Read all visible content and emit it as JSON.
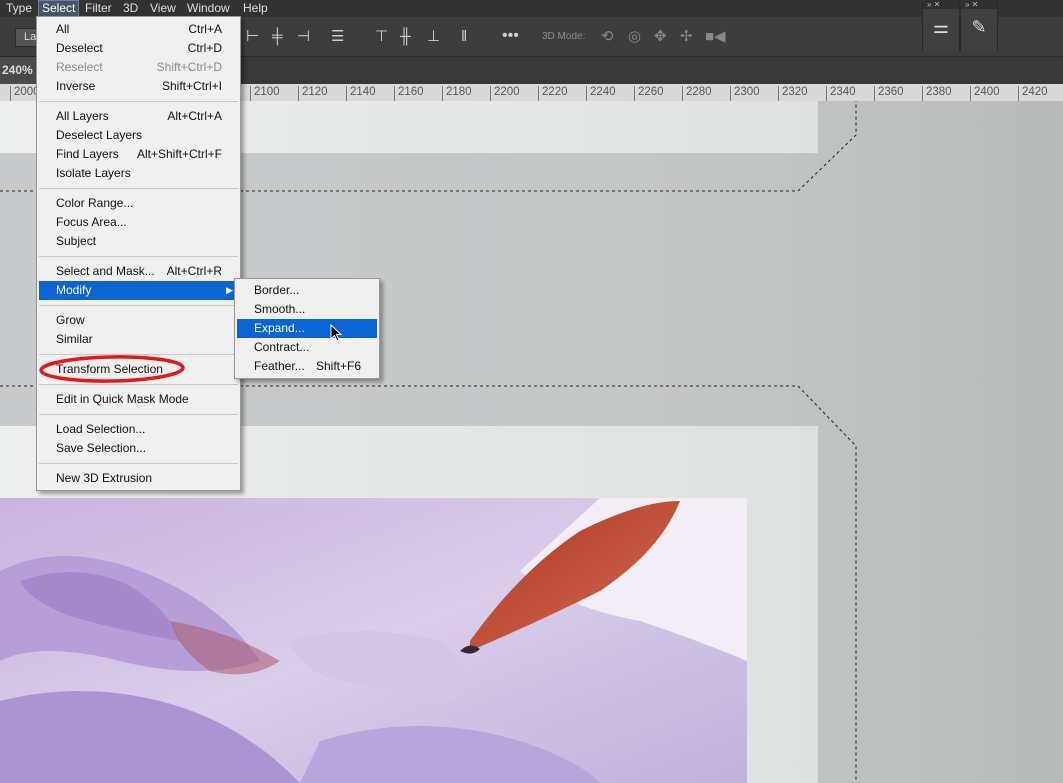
{
  "menubar": [
    "Type",
    "Select",
    "Filter",
    "3D",
    "View",
    "Window",
    "Help"
  ],
  "options": {
    "layer_dropdown": "La",
    "mode3d_label": "3D Mode:"
  },
  "zoom": "240% (",
  "ruler_ticks": [
    "2000",
    "2100",
    "2120",
    "2140",
    "2160",
    "2180",
    "2200",
    "2220",
    "2240",
    "2260",
    "2280",
    "2300",
    "2320",
    "2340",
    "2360",
    "2380",
    "2400",
    "2420"
  ],
  "select_menu": {
    "all": {
      "label": "All",
      "shortcut": "Ctrl+A"
    },
    "deselect": {
      "label": "Deselect",
      "shortcut": "Ctrl+D"
    },
    "reselect": {
      "label": "Reselect",
      "shortcut": "Shift+Ctrl+D"
    },
    "inverse": {
      "label": "Inverse",
      "shortcut": "Shift+Ctrl+I"
    },
    "all_layers": {
      "label": "All Layers",
      "shortcut": "Alt+Ctrl+A"
    },
    "deselect_layers": {
      "label": "Deselect Layers",
      "shortcut": ""
    },
    "find_layers": {
      "label": "Find Layers",
      "shortcut": "Alt+Shift+Ctrl+F"
    },
    "isolate_layers": {
      "label": "Isolate Layers",
      "shortcut": ""
    },
    "color_range": {
      "label": "Color Range...",
      "shortcut": ""
    },
    "focus_area": {
      "label": "Focus Area...",
      "shortcut": ""
    },
    "subject": {
      "label": "Subject",
      "shortcut": ""
    },
    "select_and_mask": {
      "label": "Select and Mask...",
      "shortcut": "Alt+Ctrl+R"
    },
    "modify": {
      "label": "Modify",
      "shortcut": ""
    },
    "grow": {
      "label": "Grow",
      "shortcut": ""
    },
    "similar": {
      "label": "Similar",
      "shortcut": ""
    },
    "transform_selection": {
      "label": "Transform Selection",
      "shortcut": ""
    },
    "quick_mask": {
      "label": "Edit in Quick Mask Mode",
      "shortcut": ""
    },
    "load_selection": {
      "label": "Load Selection...",
      "shortcut": ""
    },
    "save_selection": {
      "label": "Save Selection...",
      "shortcut": ""
    },
    "new_3d_extrusion": {
      "label": "New 3D Extrusion",
      "shortcut": ""
    }
  },
  "modify_submenu": {
    "border": {
      "label": "Border...",
      "shortcut": ""
    },
    "smooth": {
      "label": "Smooth...",
      "shortcut": ""
    },
    "expand": {
      "label": "Expand...",
      "shortcut": ""
    },
    "contract": {
      "label": "Contract...",
      "shortcut": ""
    },
    "feather": {
      "label": "Feather...",
      "shortcut": "Shift+F6"
    }
  },
  "colors": {
    "highlight": "#0a64d2",
    "annotation": "#e8161b"
  }
}
